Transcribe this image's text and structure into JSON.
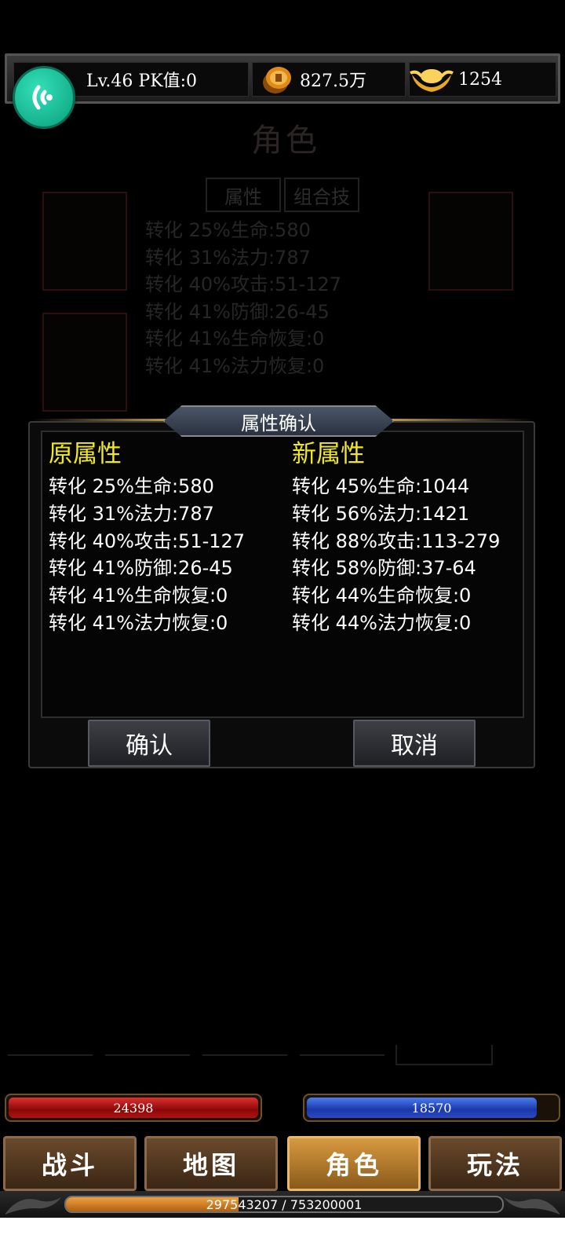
{
  "topbar": {
    "level_text": "Lv.46 PK值:0",
    "money": "827.5万",
    "gold": "1254",
    "icons": {
      "float": "assistant-bubble-icon",
      "coin": "coin-stack-icon",
      "ingot": "gold-ingot-icon"
    }
  },
  "background": {
    "title": "角色",
    "tabs": [
      "属性",
      "组合技"
    ],
    "attrs": [
      "转化 25%生命:580",
      "转化 31%法力:787",
      "转化 40%攻击:51-127",
      "转化 41%防御:26-45",
      "转化 41%生命恢复:0",
      "转化 41%法力恢复:0"
    ]
  },
  "dialog": {
    "title": "属性确认",
    "old": {
      "heading": "原属性",
      "rows": [
        "转化 25%生命:580",
        "转化 31%法力:787",
        "转化 40%攻击:51-127",
        "转化 41%防御:26-45",
        "转化 41%生命恢复:0",
        "转化 41%法力恢复:0"
      ]
    },
    "new": {
      "heading": "新属性",
      "rows": [
        "转化 45%生命:1044",
        "转化 56%法力:1421",
        "转化 88%攻击:113-279",
        "转化 58%防御:37-64",
        "转化 44%生命恢复:0",
        "转化 44%法力恢复:0"
      ]
    },
    "confirm_label": "确认",
    "cancel_label": "取消"
  },
  "status": {
    "hp": "24398",
    "hp_fill": 1.0,
    "mp": "18570",
    "mp_fill": 0.92
  },
  "nav": {
    "items": [
      "战斗",
      "地图",
      "角色",
      "玩法"
    ],
    "active": "角色"
  },
  "exp": {
    "text": "297543207 / 753200001",
    "fill": 0.395
  },
  "colors": {
    "heading_yellow": "#f2e81e",
    "hp_red": "#c81818",
    "mp_blue": "#2a4ac8",
    "exp_orange": "#e08a30",
    "float_teal": "#1fc89e"
  }
}
